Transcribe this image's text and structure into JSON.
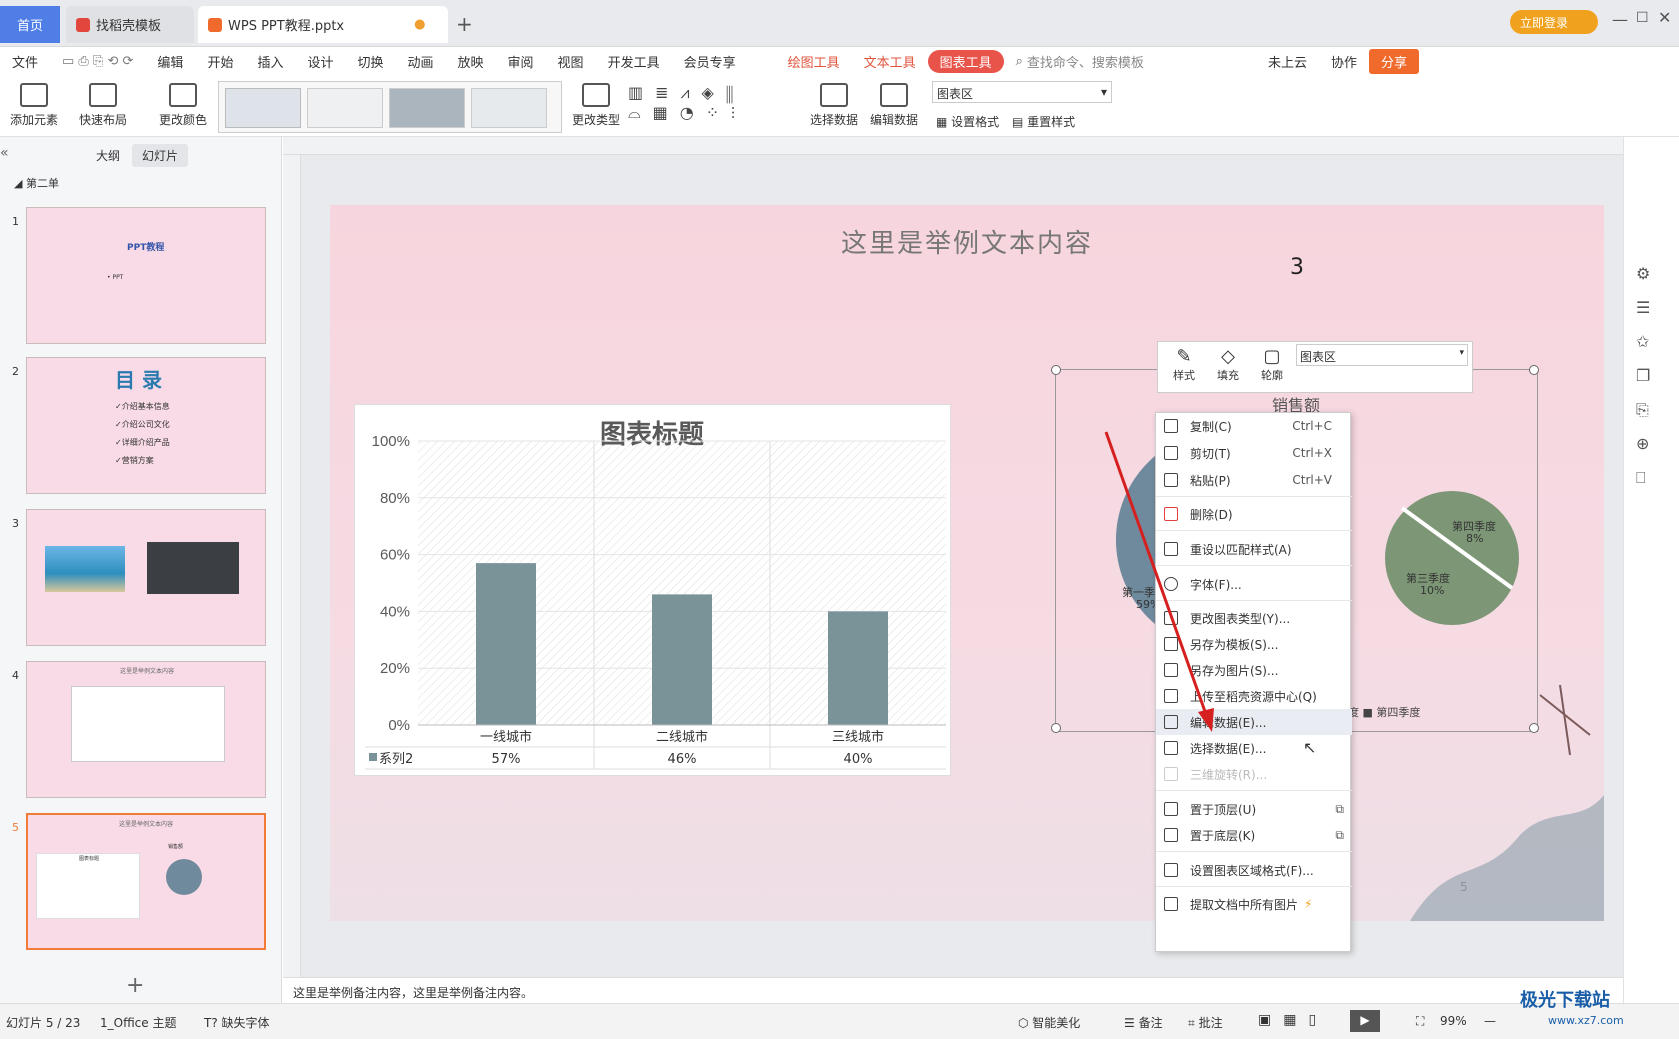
{
  "tabs": {
    "home": "首页",
    "template": "找稻壳模板",
    "doc": "WPS PPT教程.pptx",
    "login": "立即登录"
  },
  "menu": {
    "file": "文件",
    "edit": "编辑",
    "items": [
      "开始",
      "插入",
      "设计",
      "切换",
      "动画",
      "放映",
      "审阅",
      "视图",
      "开发工具",
      "会员专享"
    ],
    "draw_tools": "绘图工具",
    "text_tools": "文本工具",
    "chart_tools": "图表工具",
    "search": "查找命令、搜索模板",
    "cloud": "未上云",
    "collab": "协作",
    "share": "分享"
  },
  "ribbon": {
    "add_element": "添加元素",
    "quick_layout": "快速布局",
    "change_color": "更改颜色",
    "change_type": "更改类型",
    "select_data": "选择数据",
    "edit_data": "编辑数据",
    "area_select": "图表区",
    "set_format": "设置格式",
    "reset_style": "重置样式"
  },
  "panel": {
    "outline": "大纲",
    "slides": "幻灯片",
    "section": "第二单",
    "thumb1_title": "PPT教程",
    "thumb1_sub": "• PPT",
    "thumb2_title": "目 录",
    "thumb2_items": [
      "✓介绍基本信息",
      "✓介绍公司文化",
      "✓详细介绍产品",
      "✓营销方案"
    ],
    "thumb4_title": "这里是举例文本内容",
    "thumb5_title": "这里是举例文本内容",
    "thumb5_chart_title": "图表标题",
    "thumb5_pie_title": "销售额"
  },
  "slide": {
    "title": "这里是举例文本内容",
    "number": "3",
    "page": "5"
  },
  "chart_data": {
    "type": "bar",
    "title": "图表标题",
    "categories": [
      "一线城市",
      "二线城市",
      "三线城市"
    ],
    "series": [
      {
        "name": "系列2",
        "values": [
          0.57,
          0.46,
          0.4
        ]
      }
    ],
    "value_labels": [
      "57%",
      "46%",
      "40%"
    ],
    "yticks": [
      "100%",
      "80%",
      "60%",
      "40%",
      "20%",
      "0%"
    ],
    "ylim": [
      0,
      1
    ],
    "color": "#7a9399"
  },
  "pie": {
    "title": "销售额",
    "slice1": "第一季度",
    "slice1_val": "59%",
    "slice3": "第三季度",
    "slice3_val": "10%",
    "slice4": "第四季度",
    "slice4_val": "8%",
    "legend3": "度",
    "legend4": "第四季度"
  },
  "mini_toolbar": {
    "style": "样式",
    "fill": "填充",
    "outline": "轮廓",
    "area": "图表区"
  },
  "context_menu": {
    "copy": "复制(C)",
    "copy_sc": "Ctrl+C",
    "cut": "剪切(T)",
    "cut_sc": "Ctrl+X",
    "paste": "粘贴(P)",
    "paste_sc": "Ctrl+V",
    "delete": "删除(D)",
    "reset_style": "重设以匹配样式(A)",
    "font": "字体(F)...",
    "change_type": "更改图表类型(Y)...",
    "save_template": "另存为模板(S)...",
    "save_image": "另存为图片(S)...",
    "upload": "上传至稻壳资源中心(Q)",
    "edit_data": "编辑数据(E)...",
    "select_data": "选择数据(E)...",
    "rotate3d": "三维旋转(R)...",
    "bring_top": "置于顶层(U)",
    "send_bottom": "置于底层(K)",
    "format_area": "设置图表区域格式(F)...",
    "extract": "提取文档中所有图片"
  },
  "notes": "这里是举例备注内容，这里是举例备注内容。",
  "status": {
    "slide": "幻灯片 5 / 23",
    "theme": "1_Office 主题",
    "font": "缺失字体",
    "beautify": "智能美化",
    "notes": "备注",
    "comment": "批注",
    "zoom": "99%"
  },
  "watermark": "极光下载站",
  "watermark_url": "www.xz7.com"
}
